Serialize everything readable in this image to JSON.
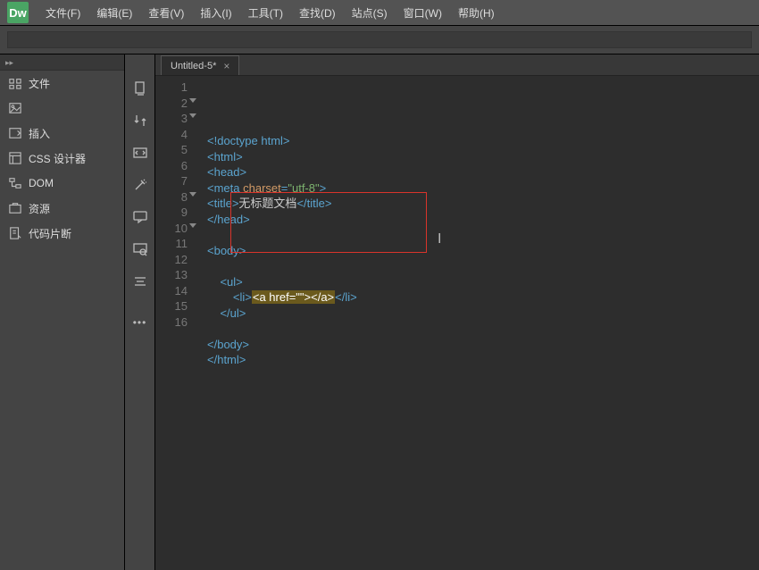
{
  "app": {
    "logo": "Dw"
  },
  "menu": [
    "文件(F)",
    "编辑(E)",
    "查看(V)",
    "插入(I)",
    "工具(T)",
    "查找(D)",
    "站点(S)",
    "窗口(W)",
    "帮助(H)"
  ],
  "panel": {
    "collapse": "▸▸",
    "items": [
      "文件",
      "",
      "插入",
      "CSS 设计器",
      "DOM",
      "资源",
      "代码片断"
    ]
  },
  "tab": {
    "title": "Untitled-5*",
    "close": "×"
  },
  "code": {
    "lines": [
      {
        "n": 1,
        "html": "<span class='angle'>&lt;!</span><span class='tag'>doctype html</span><span class='angle'>&gt;</span>"
      },
      {
        "n": 2,
        "fold": true,
        "html": "<span class='angle'>&lt;</span><span class='tag'>html</span><span class='angle'>&gt;</span>"
      },
      {
        "n": 3,
        "fold": true,
        "html": "<span class='angle'>&lt;</span><span class='tag'>head</span><span class='angle'>&gt;</span>"
      },
      {
        "n": 4,
        "html": "<span class='angle'>&lt;</span><span class='tag'>meta</span> <span class='attr'>charset</span><span class='angle'>=</span><span class='str'>\"utf-8\"</span><span class='angle'>&gt;</span>"
      },
      {
        "n": 5,
        "html": "<span class='angle'>&lt;</span><span class='tag'>title</span><span class='angle'>&gt;</span><span class='txt'>无标题文档</span><span class='angle'>&lt;/</span><span class='tag'>title</span><span class='angle'>&gt;</span>"
      },
      {
        "n": 6,
        "html": "<span class='angle'>&lt;/</span><span class='tag'>head</span><span class='angle'>&gt;</span>"
      },
      {
        "n": 7,
        "html": ""
      },
      {
        "n": 8,
        "fold": true,
        "html": "<span class='angle'>&lt;</span><span class='tag'>body</span><span class='angle'>&gt;</span>"
      },
      {
        "n": 9,
        "html": ""
      },
      {
        "n": 10,
        "fold": true,
        "html": "    <span class='angle'>&lt;</span><span class='tag'>ul</span><span class='angle'>&gt;</span>"
      },
      {
        "n": 11,
        "html": "        <span class='angle'>&lt;</span><span class='tag'>li</span><span class='angle'>&gt;</span><span class='sel'>&lt;a href=\"\"&gt;&lt;/a&gt;</span><span class='angle'>&lt;/</span><span class='tag'>li</span><span class='angle'>&gt;</span>"
      },
      {
        "n": 12,
        "html": "    <span class='angle'>&lt;/</span><span class='tag'>ul</span><span class='angle'>&gt;</span>"
      },
      {
        "n": 13,
        "html": ""
      },
      {
        "n": 14,
        "html": "<span class='angle'>&lt;/</span><span class='tag'>body</span><span class='angle'>&gt;</span>"
      },
      {
        "n": 15,
        "html": "<span class='angle'>&lt;/</span><span class='tag'>html</span><span class='angle'>&gt;</span>"
      },
      {
        "n": 16,
        "html": ""
      }
    ]
  }
}
